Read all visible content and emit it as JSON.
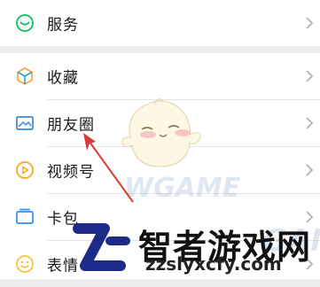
{
  "menu": {
    "items": [
      {
        "id": "services",
        "label": "服务",
        "icon": "services-icon",
        "color": "#07c160"
      },
      {
        "id": "favorites",
        "label": "收藏",
        "icon": "favorites-cube-icon",
        "color": "#2d9cdb"
      },
      {
        "id": "moments",
        "label": "朋友圈",
        "icon": "moments-picture-icon",
        "color": "#3a8bd9"
      },
      {
        "id": "channels",
        "label": "视频号",
        "icon": "channels-play-icon",
        "color": "#f5a623"
      },
      {
        "id": "cards",
        "label": "卡包",
        "icon": "card-wallet-icon",
        "color": "#2d8ef0"
      },
      {
        "id": "stickers",
        "label": "表情",
        "icon": "sticker-smile-icon",
        "color": "#f5c33b"
      }
    ]
  },
  "watermark": {
    "title": "智者游戏网",
    "url": "zzslyxcfy.com",
    "game_text": "GAME",
    "game_text_2": "WGAME"
  }
}
